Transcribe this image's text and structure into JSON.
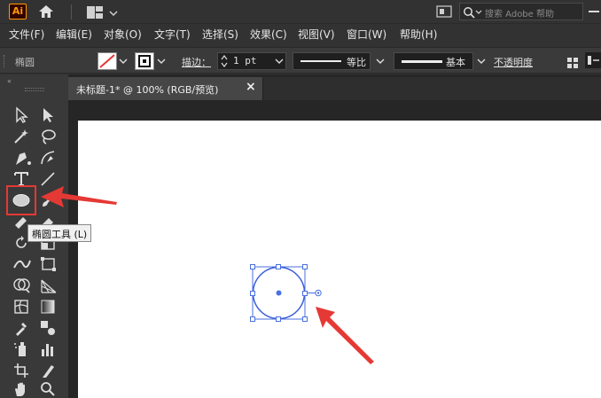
{
  "titlebar": {
    "app_logo": "Ai",
    "search_placeholder": "搜索 Adobe 帮助"
  },
  "menu": [
    {
      "label": "文件(F)"
    },
    {
      "label": "编辑(E)"
    },
    {
      "label": "对象(O)"
    },
    {
      "label": "文字(T)"
    },
    {
      "label": "选择(S)"
    },
    {
      "label": "效果(C)"
    },
    {
      "label": "视图(V)"
    },
    {
      "label": "窗口(W)"
    },
    {
      "label": "帮助(H)"
    }
  ],
  "control": {
    "object_label": "椭圆",
    "stroke_label": "描边：",
    "stroke_value": "1 pt",
    "profile_label": "等比",
    "brush_label": "基本",
    "opacity_label": "不透明度"
  },
  "document": {
    "tab_title": "未标题-1* @ 100% (RGB/预览)",
    "close_glyph": "×"
  },
  "tooltip": {
    "text": "椭圆工具 (L)"
  },
  "colors": {
    "accent": "#e53935",
    "selection": "#4a6fe0",
    "logo_bg": "#330000",
    "logo_fg": "#ff9a00"
  }
}
